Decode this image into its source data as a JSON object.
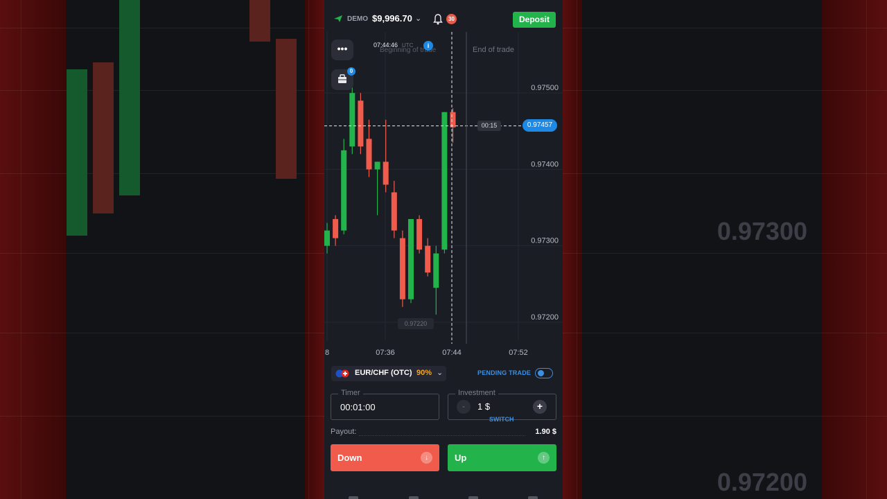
{
  "background": {
    "prices": [
      "0.97300",
      "0.97200"
    ]
  },
  "header": {
    "account_mode": "DEMO",
    "balance": "$9,996.70",
    "notifications_count": "30",
    "deposit_label": "Deposit"
  },
  "chart": {
    "current_time": "07:44:46",
    "timezone": "UTC",
    "beginning_label": "Beginning of trade",
    "end_label": "End of trade",
    "countdown": "00:15",
    "current_price": "0.97457",
    "low_price": "0.97220",
    "portfolio_count": "0",
    "price_axis": [
      "0.97500",
      "0.97400",
      "0.97300",
      "0.97200"
    ],
    "time_axis": [
      "8",
      "07:36",
      "07:44",
      "07:52"
    ]
  },
  "chart_data": {
    "type": "candlestick",
    "title": "",
    "ylim": [
      0.9715,
      0.9758
    ],
    "y_ticks": [
      0.975,
      0.974,
      0.973,
      0.972
    ],
    "x_ticks": [
      "07:36",
      "07:44",
      "07:52"
    ],
    "candles": [
      {
        "o": 0.973,
        "h": 0.9733,
        "l": 0.9729,
        "c": 0.9732,
        "color": "up"
      },
      {
        "o": 0.97335,
        "h": 0.9734,
        "l": 0.973,
        "c": 0.9731,
        "color": "down"
      },
      {
        "o": 0.9732,
        "h": 0.9744,
        "l": 0.97315,
        "c": 0.97425,
        "color": "up"
      },
      {
        "o": 0.9743,
        "h": 0.9751,
        "l": 0.9742,
        "c": 0.975,
        "color": "up"
      },
      {
        "o": 0.9749,
        "h": 0.975,
        "l": 0.9742,
        "c": 0.9743,
        "color": "down"
      },
      {
        "o": 0.9744,
        "h": 0.97465,
        "l": 0.9739,
        "c": 0.974,
        "color": "down"
      },
      {
        "o": 0.974,
        "h": 0.9741,
        "l": 0.9734,
        "c": 0.9741,
        "color": "up"
      },
      {
        "o": 0.9741,
        "h": 0.97465,
        "l": 0.9737,
        "c": 0.9738,
        "color": "down"
      },
      {
        "o": 0.9737,
        "h": 0.97385,
        "l": 0.9731,
        "c": 0.9732,
        "color": "down"
      },
      {
        "o": 0.9731,
        "h": 0.9732,
        "l": 0.9722,
        "c": 0.9723,
        "color": "down"
      },
      {
        "o": 0.9723,
        "h": 0.97335,
        "l": 0.97225,
        "c": 0.97335,
        "color": "up"
      },
      {
        "o": 0.97335,
        "h": 0.9734,
        "l": 0.9729,
        "c": 0.97295,
        "color": "down"
      },
      {
        "o": 0.973,
        "h": 0.9731,
        "l": 0.9726,
        "c": 0.97265,
        "color": "down"
      },
      {
        "o": 0.97245,
        "h": 0.973,
        "l": 0.9721,
        "c": 0.9729,
        "color": "up"
      },
      {
        "o": 0.97295,
        "h": 0.97475,
        "l": 0.9729,
        "c": 0.97475,
        "color": "up"
      },
      {
        "o": 0.97475,
        "h": 0.9748,
        "l": 0.97435,
        "c": 0.97455,
        "color": "down"
      }
    ]
  },
  "trade": {
    "asset": "EUR/CHF (OTC)",
    "payout_pct": "90%",
    "pending_label": "PENDING TRADE",
    "timer_label": "Timer",
    "timer_value": "00:01:00",
    "investment_label": "Investment",
    "investment_value": "1 $",
    "minus_label": "-",
    "plus_label": "+",
    "switch_label": "SWITCH",
    "payout_label": "Payout:",
    "payout_value": "1.90 $",
    "down_label": "Down",
    "up_label": "Up"
  },
  "colors": {
    "up": "#22b34b",
    "down": "#f05b4b",
    "accent": "#1e88e5",
    "background": "#1b1d25"
  }
}
